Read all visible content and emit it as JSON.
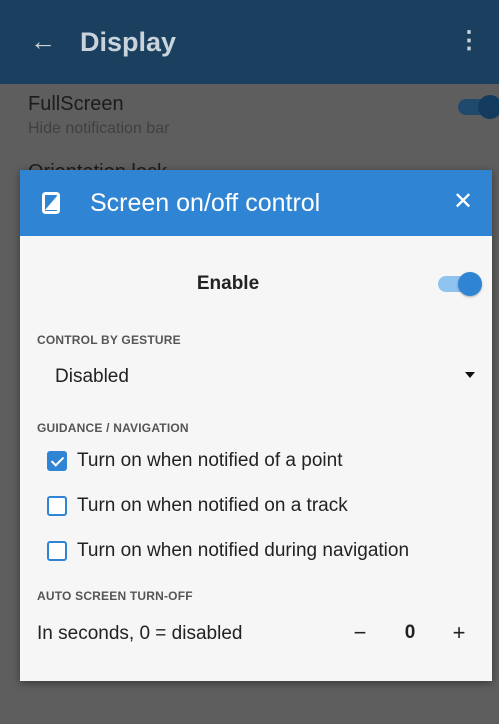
{
  "appbar": {
    "title": "Display",
    "back_icon": "arrow-left-icon",
    "menu_icon": "more-vert-icon"
  },
  "background": {
    "fullscreen_title": "FullScreen",
    "fullscreen_subtitle": "Hide notification bar",
    "fullscreen_enabled": true,
    "next_item_title": "Orientation lock"
  },
  "dialog": {
    "title": "Screen on/off control",
    "title_icon": "phone-screen-icon",
    "close_icon": "close-icon",
    "enable_label": "Enable",
    "enable_on": true,
    "gesture_section": "CONTROL BY GESTURE",
    "gesture_value": "Disabled",
    "guidance_section": "GUIDANCE / NAVIGATION",
    "guidance_options": [
      {
        "label": "Turn on when notified of a point",
        "checked": true
      },
      {
        "label": "Turn on when notified on a track",
        "checked": false
      },
      {
        "label": "Turn on when notified during navigation",
        "checked": false
      }
    ],
    "auto_section": "AUTO SCREEN TURN-OFF",
    "seconds_label": "In seconds, 0 = disabled",
    "seconds_value": "0",
    "minus_label": "−",
    "plus_label": "+"
  },
  "colors": {
    "accent": "#2f84d3",
    "appbar": "#1b3f5e",
    "dim": "#5e5e5e"
  }
}
